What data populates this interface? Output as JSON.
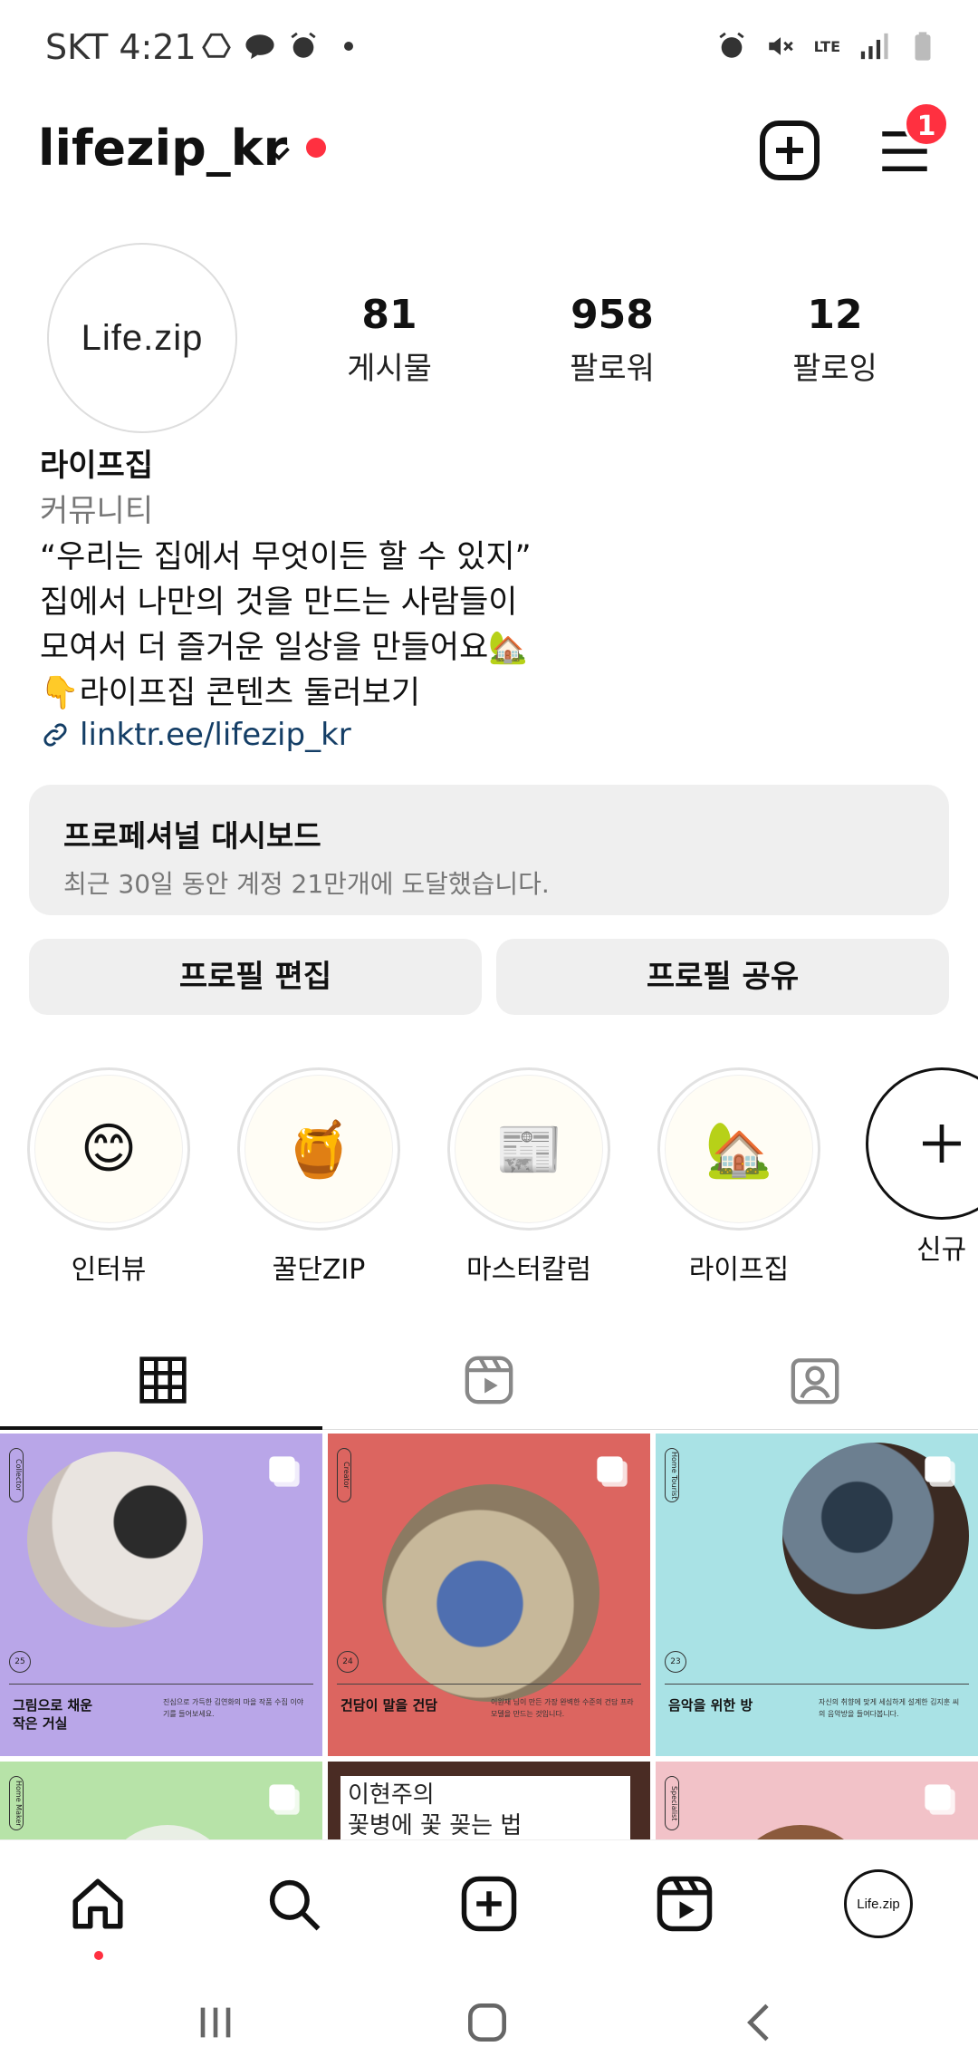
{
  "status_bar": {
    "time": "SKT 4:21",
    "left_icons": [
      "drive-icon",
      "talk-icon",
      "alarm-icon"
    ],
    "right_icons": [
      "alarm-icon",
      "mute-icon",
      "lte-icon",
      "signal-icon",
      "battery-icon"
    ],
    "lte_label": "LTE"
  },
  "header": {
    "username": "lifezip_kr",
    "notification_count": "1"
  },
  "profile": {
    "avatar_text": "Life.zip",
    "stats": [
      {
        "value": "81",
        "label": "게시물"
      },
      {
        "value": "958",
        "label": "팔로워"
      },
      {
        "value": "12",
        "label": "팔로잉"
      }
    ],
    "name": "라이프집",
    "category": "커뮤니티",
    "bio_lines": [
      "“우리는 집에서 무엇이든 할 수 있지”",
      "집에서 나만의 것을 만드는 사람들이",
      "모여서 더 즐거운 일상을 만들어요🏡",
      "👇라이프집 콘텐츠 둘러보기"
    ],
    "link": "linktr.ee/lifezip_kr"
  },
  "dashboard": {
    "title": "프로페셔널 대시보드",
    "subtitle": "최근 30일 동안 계정 21만개에 도달했습니다."
  },
  "buttons": {
    "edit_profile": "프로필 편집",
    "share_profile": "프로필 공유"
  },
  "highlights": [
    {
      "label": "인터뷰",
      "emoji": "😊"
    },
    {
      "label": "꿀단ZIP",
      "emoji": "🍯"
    },
    {
      "label": "마스터칼럼",
      "emoji": "📰"
    },
    {
      "label": "라이프집",
      "emoji": "🏡"
    },
    {
      "label": "신규",
      "emoji": "+"
    }
  ],
  "tabs": [
    "grid-icon",
    "reels-icon",
    "tagged-icon"
  ],
  "grid": [
    {
      "bg": "#b9a6e8",
      "tag": "Collector",
      "num": "25",
      "title": "그림으로 채운\n작은 거실",
      "desc": "진심으로 가득한 김연화의 마을 작품 수집 이야기를 들어보세요."
    },
    {
      "bg": "#dc6560",
      "tag": "Creator",
      "num": "24",
      "title": "건담이 말을 건담",
      "desc": "이원재 님이 만든 가장 완벽한 수준의 건담 프라모델을 만드는 것입니다."
    },
    {
      "bg": "#a9e2e5",
      "tag": "Home Tourist",
      "num": "23",
      "title": "음악을 위한 방",
      "desc": "자신의 취향에 맞게 세심하게 설계한 김지훈 씨의 음악방을 들여다봅니다."
    },
    {
      "bg": "#b7e3a8",
      "tag": "Home Maker",
      "num": "",
      "title": "",
      "desc": ""
    },
    {
      "bg": "#4a2c24",
      "tag": "",
      "num": "",
      "title": "이현주의\n꽃병에 꽃 꽂는 법",
      "desc": ""
    },
    {
      "bg": "#f2c2c8",
      "tag": "Specialist",
      "num": "",
      "title": "",
      "desc": ""
    }
  ],
  "bottom_nav": [
    "home-icon",
    "search-icon",
    "create-icon",
    "reels-icon",
    "profile-avatar"
  ],
  "bottom_nav_avatar_text": "Life.zip",
  "colors": {
    "accent_red": "#ff3040",
    "link_blue": "#143e66",
    "button_bg": "#efefef"
  }
}
